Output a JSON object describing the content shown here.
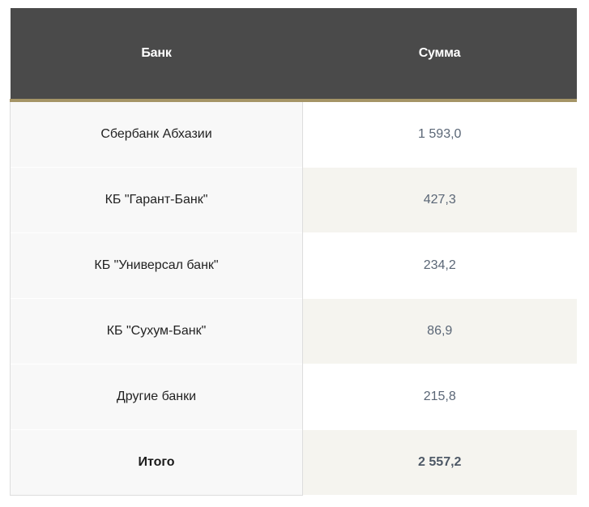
{
  "table": {
    "headers": {
      "bank": "Банк",
      "sum": "Сумма"
    },
    "rows": [
      {
        "bank": "Сбербанк Абхазии",
        "sum": "1 593,0"
      },
      {
        "bank": "КБ \"Гарант-Банк\"",
        "sum": "427,3"
      },
      {
        "bank": "КБ \"Универсал банк\"",
        "sum": "234,2"
      },
      {
        "bank": "КБ \"Сухум-Банк\"",
        "sum": "86,9"
      },
      {
        "bank": "Другие банки",
        "sum": "215,8"
      },
      {
        "bank": "Итого",
        "sum": "2 557,2"
      }
    ]
  },
  "colors": {
    "header_bg": "#4a4a4a",
    "header_accent": "#a59466",
    "sum_text": "#5a6676",
    "alt_row_bg": "#f5f4ef"
  }
}
